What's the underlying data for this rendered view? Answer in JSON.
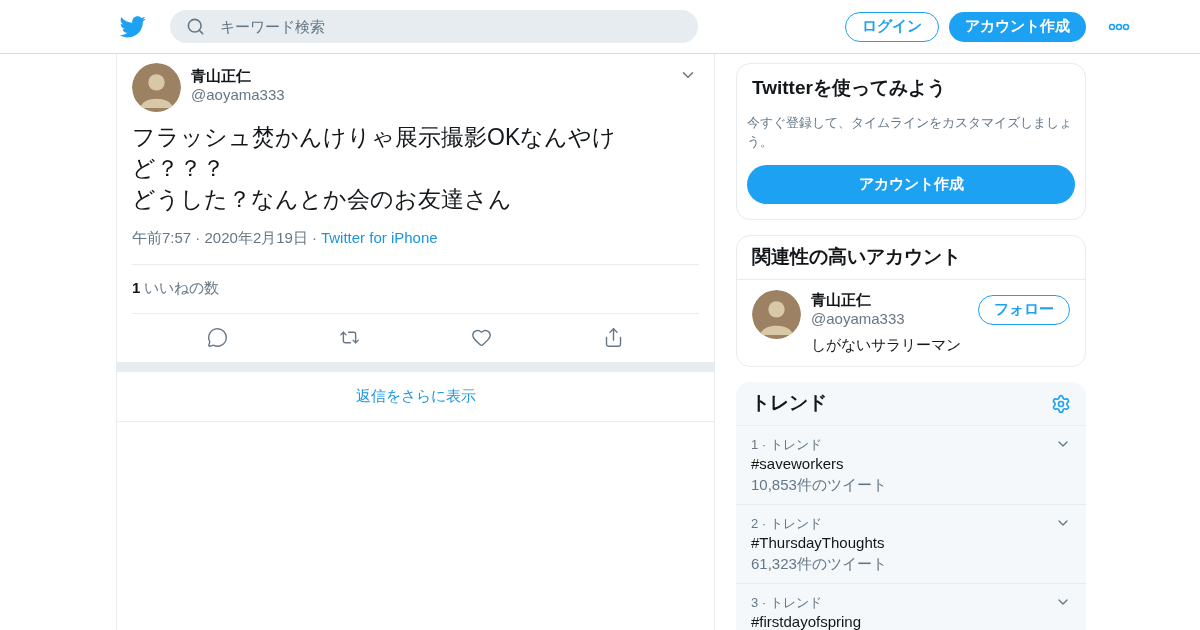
{
  "header": {
    "search": {
      "placeholder": "キーワード検索"
    },
    "login": "ログイン",
    "signup": "アカウント作成"
  },
  "tweet": {
    "name": "青山正仁",
    "handle": "@aoyama333",
    "lines": [
      "フラッシュ焚かんけりゃ展示撮影OKなんやけど？？？",
      "どうした？なんとか会のお友達さん"
    ],
    "time": "午前7:57 · 2020年2月19日",
    "separator": "·",
    "source": "Twitter for iPhone",
    "likes_count": "1",
    "likes_label": "いいねの数",
    "more_replies": "返信をさらに表示"
  },
  "signup_card": {
    "title": "Twitterを使ってみよう",
    "text": "今すぐ登録して、タイムラインをカスタマイズしましょう。",
    "button": "アカウント作成"
  },
  "related": {
    "title": "関連性の高いアカウント",
    "accounts": [
      {
        "name": "青山正仁",
        "handle": "@aoyama333",
        "bio": "しがないサラリーマン",
        "follow": "フォロー"
      }
    ]
  },
  "trends": {
    "title": "トレンド",
    "items": [
      {
        "rank": "1 · トレンド",
        "name": "#saveworkers",
        "count": "10,853件のツイート"
      },
      {
        "rank": "2 · トレンド",
        "name": "#ThursdayThoughts",
        "count": "61,323件のツイート"
      },
      {
        "rank": "3 · トレンド",
        "name": "#firstdayofspring"
      }
    ]
  }
}
